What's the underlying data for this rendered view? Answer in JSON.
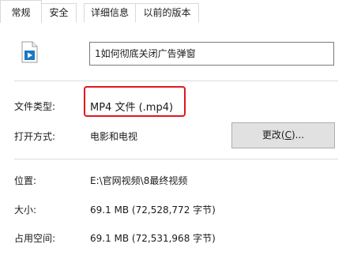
{
  "tabs": [
    {
      "label": "常规",
      "active": true
    },
    {
      "label": "安全",
      "active": false
    },
    {
      "label": "详细信息",
      "active": false
    },
    {
      "label": "以前的版本",
      "active": false
    }
  ],
  "file": {
    "icon": "video-file-icon",
    "name": "1如何彻底关闭广告弹窗"
  },
  "rows": {
    "file_type": {
      "label": "文件类型:",
      "value": "MP4 文件 (.mp4)"
    },
    "open_with": {
      "label": "打开方式:",
      "value": "电影和电视"
    },
    "location": {
      "label": "位置:",
      "value": "E:\\官网视频\\8最终视频"
    },
    "size": {
      "label": "大小:",
      "value": "69.1 MB (72,528,772 字节)"
    },
    "size_on_disk": {
      "label": "占用空间:",
      "value": "69.1 MB (72,531,968 字节)"
    }
  },
  "change_button": {
    "prefix": "更改(",
    "accel": "C",
    "suffix": ")..."
  },
  "colors": {
    "highlight": "#e3161c",
    "button_bg": "#e1e1e1",
    "icon_blue": "#1a78c2"
  }
}
